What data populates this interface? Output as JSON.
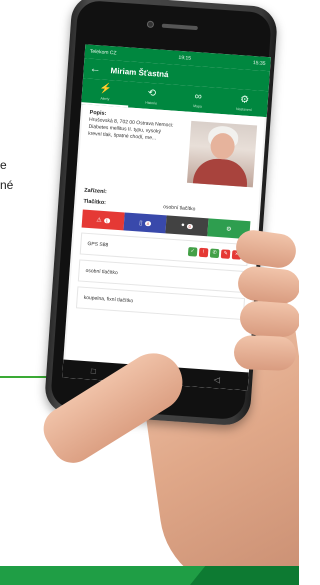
{
  "side_text": {
    "line1": "e",
    "line2": "né"
  },
  "status_bar": {
    "carrier": "Telekom CZ",
    "signal_text": "19:15",
    "time": "15:35"
  },
  "app_bar": {
    "title": "Miriam Šťastná"
  },
  "tabs": [
    {
      "label": "Alerty",
      "icon": "bolt-icon",
      "glyph": "⚡"
    },
    {
      "label": "Historie",
      "icon": "history-icon",
      "glyph": "⟲"
    },
    {
      "label": "Mapa",
      "icon": "glasses-icon",
      "glyph": "∞"
    },
    {
      "label": "Nastavení",
      "icon": "settings-icon",
      "glyph": "⚙"
    }
  ],
  "profile": {
    "popis_label": "Popis:",
    "popis_text": "Hrušovská 8, 702 00 Ostrava Nemoci: Diabetes mellitus II. typu, vysoký krevní tlak, špatné chodí, me..."
  },
  "zarizeni_label": "Zařízení:",
  "tlacitka": {
    "label": "Tlačítko:",
    "value": "osobní tlačítko"
  },
  "action_buttons": [
    {
      "glyph": "⚠",
      "badge": "1",
      "color": "#e53935",
      "name": "alarm"
    },
    {
      "glyph": "▯",
      "badge": "4",
      "color": "#3949ab",
      "name": "battery"
    },
    {
      "glyph": "●",
      "badge": "0",
      "color": "#424242",
      "name": "status"
    },
    {
      "glyph": "⚙",
      "badge": "",
      "color": "#2e9e4f",
      "name": "settings"
    }
  ],
  "gps_card": {
    "label": "GPS S88",
    "buttons": [
      {
        "glyph": "✓",
        "color": "#43a047"
      },
      {
        "glyph": "!",
        "color": "#e53935"
      },
      {
        "glyph": "✆",
        "color": "#43a047"
      },
      {
        "glyph": "✎",
        "color": "#e53935"
      },
      {
        "glyph": "×",
        "color": "#e53935"
      }
    ]
  },
  "list_items": [
    "osobní tlačítko",
    "koupelna, fixní tlačítko"
  ],
  "nav_bar": {
    "square": "□",
    "circle": "○",
    "back": "◁"
  },
  "colors": {
    "primary": "#00873f",
    "band": "#1f9e45"
  }
}
